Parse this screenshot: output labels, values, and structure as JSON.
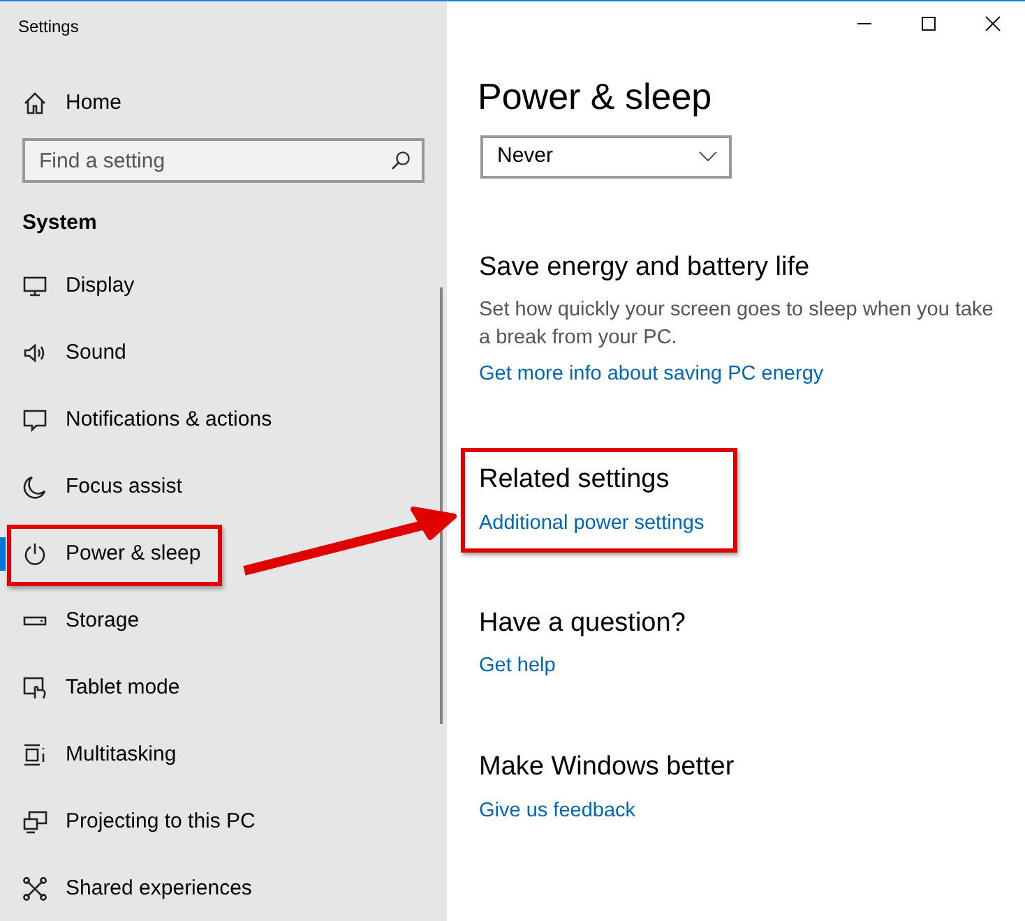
{
  "window": {
    "title": "Settings"
  },
  "sidebar": {
    "home": "Home",
    "search": {
      "placeholder": "Find a setting"
    },
    "section": "System",
    "items": [
      {
        "label": "Display",
        "selected": false,
        "outlined": false
      },
      {
        "label": "Sound",
        "selected": false,
        "outlined": false
      },
      {
        "label": "Notifications & actions",
        "selected": false,
        "outlined": false
      },
      {
        "label": "Focus assist",
        "selected": false,
        "outlined": false
      },
      {
        "label": "Power & sleep",
        "selected": true,
        "outlined": true
      },
      {
        "label": "Storage",
        "selected": false,
        "outlined": false
      },
      {
        "label": "Tablet mode",
        "selected": false,
        "outlined": false
      },
      {
        "label": "Multitasking",
        "selected": false,
        "outlined": false
      },
      {
        "label": "Projecting to this PC",
        "selected": false,
        "outlined": false
      },
      {
        "label": "Shared experiences",
        "selected": false,
        "outlined": false
      }
    ]
  },
  "content": {
    "title": "Power & sleep",
    "dropdown": {
      "value": "Never"
    },
    "sections": [
      {
        "heading": "Save energy and battery life",
        "description": "Set how quickly your screen goes to sleep when you take a break from your PC.",
        "links": [
          "Get more info about saving PC energy"
        ],
        "outlined": false
      },
      {
        "heading": "Related settings",
        "links": [
          "Additional power settings"
        ],
        "outlined": true
      },
      {
        "heading": "Have a question?",
        "links": [
          "Get help"
        ],
        "outlined": false
      },
      {
        "heading": "Make Windows better",
        "links": [
          "Give us feedback"
        ],
        "outlined": false
      }
    ]
  },
  "callout_arrow": true
}
